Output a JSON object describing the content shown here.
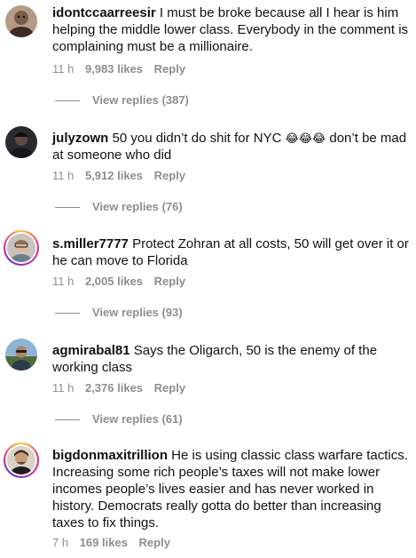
{
  "comments": [
    {
      "username": "idontccaarreesir",
      "text": "I must be broke because all I hear is him helping the middle lower class. Everybody in the comment is complaining must be a millionaire.",
      "time": "11 h",
      "likes": "9,983 likes",
      "reply": "Reply",
      "view_replies": "View replies (387)",
      "avatar_icon": "user-avatar-icon"
    },
    {
      "username": "julyzown",
      "text_before": "50 you didn’t do shit for NYC ",
      "emoji": "😂😂😂",
      "text_after": " don’t be mad at someone who did",
      "time": "11 h",
      "likes": "5,912 likes",
      "reply": "Reply",
      "view_replies": "View replies (76)",
      "avatar_icon": "user-avatar-icon"
    },
    {
      "username": "s.miller7777",
      "text": "Protect Zohran at all costs, 50 will get over it or he can move to Florida",
      "time": "11 h",
      "likes": "2,005 likes",
      "reply": "Reply",
      "view_replies": "View replies (93)",
      "avatar_icon": "story-ring-avatar-icon"
    },
    {
      "username": "agmirabal81",
      "text": "Says the Oligarch, 50 is the enemy of the working class",
      "time": "11 h",
      "likes": "2,376 likes",
      "reply": "Reply",
      "view_replies": "View replies (61)",
      "avatar_icon": "user-avatar-icon"
    },
    {
      "username": "bigdonmaxitrillion",
      "text": "He is using classic class warfare tactics. Increasing some rich people’s taxes will not make lower incomes people’s lives easier and has never worked in history. Democrats really gotta do better than increasing taxes to fix things.",
      "time": "7 h",
      "likes": "169 likes",
      "reply": "Reply",
      "avatar_icon": "story-ring-avatar-icon"
    }
  ],
  "colors": {
    "meta_gray": "#8e8e8e",
    "text": "#111111",
    "background": "#ffffff"
  }
}
